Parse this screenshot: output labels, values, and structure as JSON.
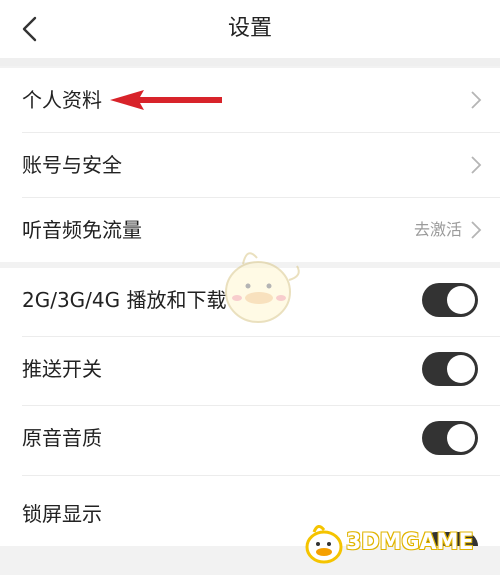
{
  "header": {
    "title": "设置"
  },
  "group1": [
    {
      "label": "个人资料",
      "extra": ""
    },
    {
      "label": "账号与安全",
      "extra": ""
    },
    {
      "label": "听音频免流量",
      "extra": "去激活"
    }
  ],
  "group2": [
    {
      "label": "2G/3G/4G 播放和下载",
      "toggle": "on"
    },
    {
      "label": "推送开关",
      "toggle": "on"
    },
    {
      "label": "原音音质",
      "toggle": "on"
    },
    {
      "label": "锁屏显示",
      "toggle": "on"
    }
  ],
  "watermark": {
    "text": "3DMGAME"
  },
  "colors": {
    "toggle_on": "#333333",
    "arrow": "#d8232a",
    "accent_yellow": "#f5c400"
  }
}
